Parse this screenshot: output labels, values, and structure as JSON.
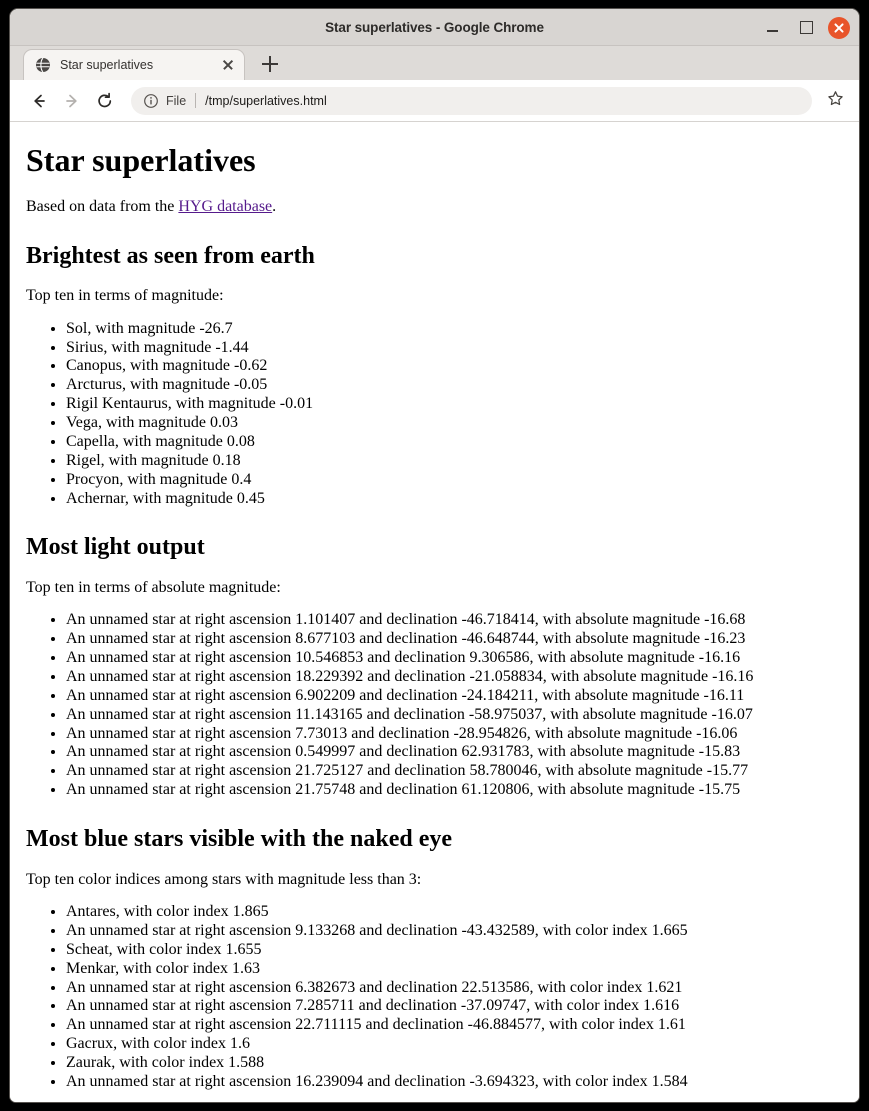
{
  "window": {
    "title": "Star superlatives - Google Chrome",
    "controls": {
      "minimize": "minimize",
      "maximize": "maximize",
      "close": "close"
    },
    "close_color": "#e8542a",
    "titlebar_color": "#d8d5d2"
  },
  "tabstrip": {
    "tabs": [
      {
        "title": "Star superlatives",
        "favicon": "globe-icon",
        "close_label": "close-tab"
      }
    ],
    "new_tab_label": "new-tab"
  },
  "toolbar": {
    "back_label": "Back",
    "forward_label": "Forward",
    "reload_label": "Reload",
    "omnibox": {
      "scheme_label": "File",
      "url": "/tmp/superlatives.html",
      "info_icon": "info-circle-icon"
    },
    "bookmark_label": "Bookmark this tab",
    "bookmark_icon": "star-outline-icon"
  },
  "page": {
    "title": "Star superlatives",
    "intro_prefix": "Based on data from the ",
    "intro_link": "HYG database",
    "intro_suffix": ".",
    "link_color": "#551a8b",
    "sections": [
      {
        "heading": "Brightest as seen from earth",
        "lead": "Top ten in terms of magnitude:",
        "items": [
          "Sol, with magnitude -26.7",
          "Sirius, with magnitude -1.44",
          "Canopus, with magnitude -0.62",
          "Arcturus, with magnitude -0.05",
          "Rigil Kentaurus, with magnitude -0.01",
          "Vega, with magnitude 0.03",
          "Capella, with magnitude 0.08",
          "Rigel, with magnitude 0.18",
          "Procyon, with magnitude 0.4",
          "Achernar, with magnitude 0.45"
        ]
      },
      {
        "heading": "Most light output",
        "lead": "Top ten in terms of absolute magnitude:",
        "items": [
          "An unnamed star at right ascension 1.101407 and declination -46.718414, with absolute magnitude -16.68",
          "An unnamed star at right ascension 8.677103 and declination -46.648744, with absolute magnitude -16.23",
          "An unnamed star at right ascension 10.546853 and declination 9.306586, with absolute magnitude -16.16",
          "An unnamed star at right ascension 18.229392 and declination -21.058834, with absolute magnitude -16.16",
          "An unnamed star at right ascension 6.902209 and declination -24.184211, with absolute magnitude -16.11",
          "An unnamed star at right ascension 11.143165 and declination -58.975037, with absolute magnitude -16.07",
          "An unnamed star at right ascension 7.73013 and declination -28.954826, with absolute magnitude -16.06",
          "An unnamed star at right ascension 0.549997 and declination 62.931783, with absolute magnitude -15.83",
          "An unnamed star at right ascension 21.725127 and declination 58.780046, with absolute magnitude -15.77",
          "An unnamed star at right ascension 21.75748 and declination 61.120806, with absolute magnitude -15.75"
        ]
      },
      {
        "heading": "Most blue stars visible with the naked eye",
        "lead": "Top ten color indices among stars with magnitude less than 3:",
        "items": [
          "Antares, with color index 1.865",
          "An unnamed star at right ascension 9.133268 and declination -43.432589, with color index 1.665",
          "Scheat, with color index 1.655",
          "Menkar, with color index 1.63",
          "An unnamed star at right ascension 6.382673 and declination 22.513586, with color index 1.621",
          "An unnamed star at right ascension 7.285711 and declination -37.09747, with color index 1.616",
          "An unnamed star at right ascension 22.711115 and declination -46.884577, with color index 1.61",
          "Gacrux, with color index 1.6",
          "Zaurak, with color index 1.588",
          "An unnamed star at right ascension 16.239094 and declination -3.694323, with color index 1.584"
        ]
      }
    ]
  }
}
